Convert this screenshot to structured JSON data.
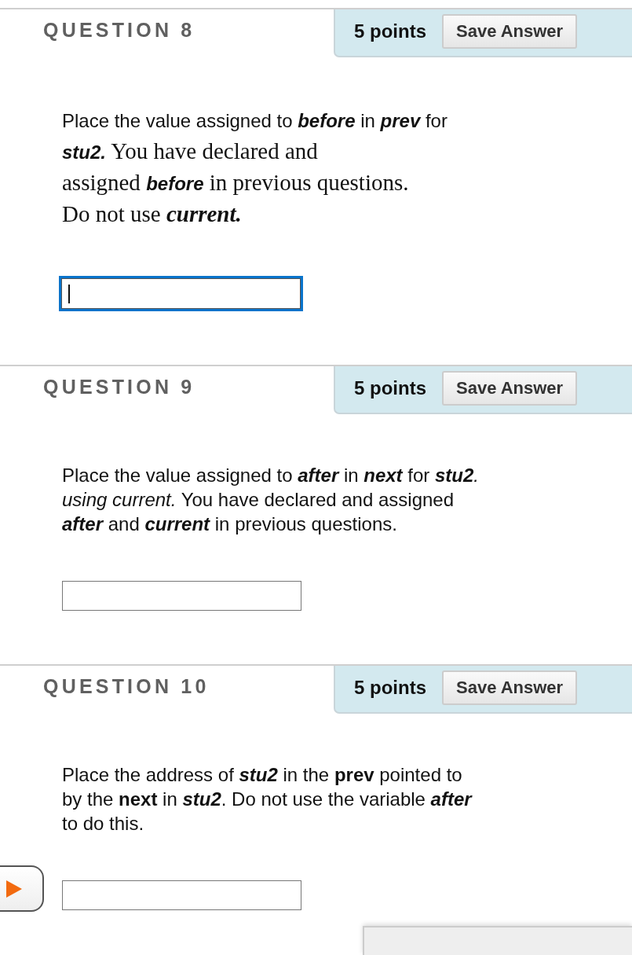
{
  "questions": [
    {
      "title": "QUESTION 8",
      "points": "5 points",
      "button": "Save Answer",
      "prompt": [
        {
          "kind": "sans",
          "text": "Place the value assigned to "
        },
        {
          "kind": "sans-emphasis",
          "text": "before"
        },
        {
          "kind": "sans",
          "text": " in "
        },
        {
          "kind": "sans-emphasis",
          "text": "prev"
        },
        {
          "kind": "sans",
          "text": " for "
        },
        {
          "kind": "sans-emphasis",
          "text": "stu2."
        },
        {
          "kind": "serif",
          "text": " You have declared and"
        },
        {
          "kind": "break"
        },
        {
          "kind": "serif",
          "text": "assigned "
        },
        {
          "kind": "sans-emphasis",
          "text": "before"
        },
        {
          "kind": "serif",
          "text": " in previous questions."
        },
        {
          "kind": "break"
        },
        {
          "kind": "serif",
          "text": "Do not use "
        },
        {
          "kind": "serif-emphasis",
          "text": "current."
        }
      ],
      "answer": {
        "focused": true
      }
    },
    {
      "title": "QUESTION 9",
      "points": "5 points",
      "button": "Save Answer",
      "prompt": [
        {
          "kind": "sans",
          "text": "Place the value assigned to "
        },
        {
          "kind": "sans-emphasis",
          "text": "after"
        },
        {
          "kind": "sans",
          "text": " in "
        },
        {
          "kind": "sans-emphasis",
          "text": "next"
        },
        {
          "kind": "sans",
          "text": " for "
        },
        {
          "kind": "sans-emphasis",
          "text": "stu2"
        },
        {
          "kind": "sans",
          "text": "*. using  current.* You have declared and assigned "
        },
        {
          "kind": "sans-emphasis",
          "text": "after"
        },
        {
          "kind": "sans",
          "text": " and "
        },
        {
          "kind": "sans-emphasis",
          "text": "current"
        },
        {
          "kind": "sans",
          "text": " in previous questions."
        }
      ],
      "answer": {
        "focused": false
      }
    },
    {
      "title": "QUESTION 10",
      "points": "5 points",
      "button": "Save Answer",
      "prompt": [
        {
          "kind": "sans",
          "text": "Place the address of "
        },
        {
          "kind": "sans-emphasis",
          "text": "stu2"
        },
        {
          "kind": "sans",
          "text": " in the **prev** pointed to by the **next** in "
        },
        {
          "kind": "sans-emphasis",
          "text": "stu2"
        },
        {
          "kind": "sans",
          "text": ". Do not use the variable "
        },
        {
          "kind": "sans-emphasis",
          "text": "after"
        },
        {
          "kind": "sans",
          "text": " to do this."
        }
      ],
      "answer": {
        "focused": false
      }
    }
  ],
  "side_button": {
    "kind": "play"
  },
  "submit_panel": {
    "kind": "panel"
  }
}
